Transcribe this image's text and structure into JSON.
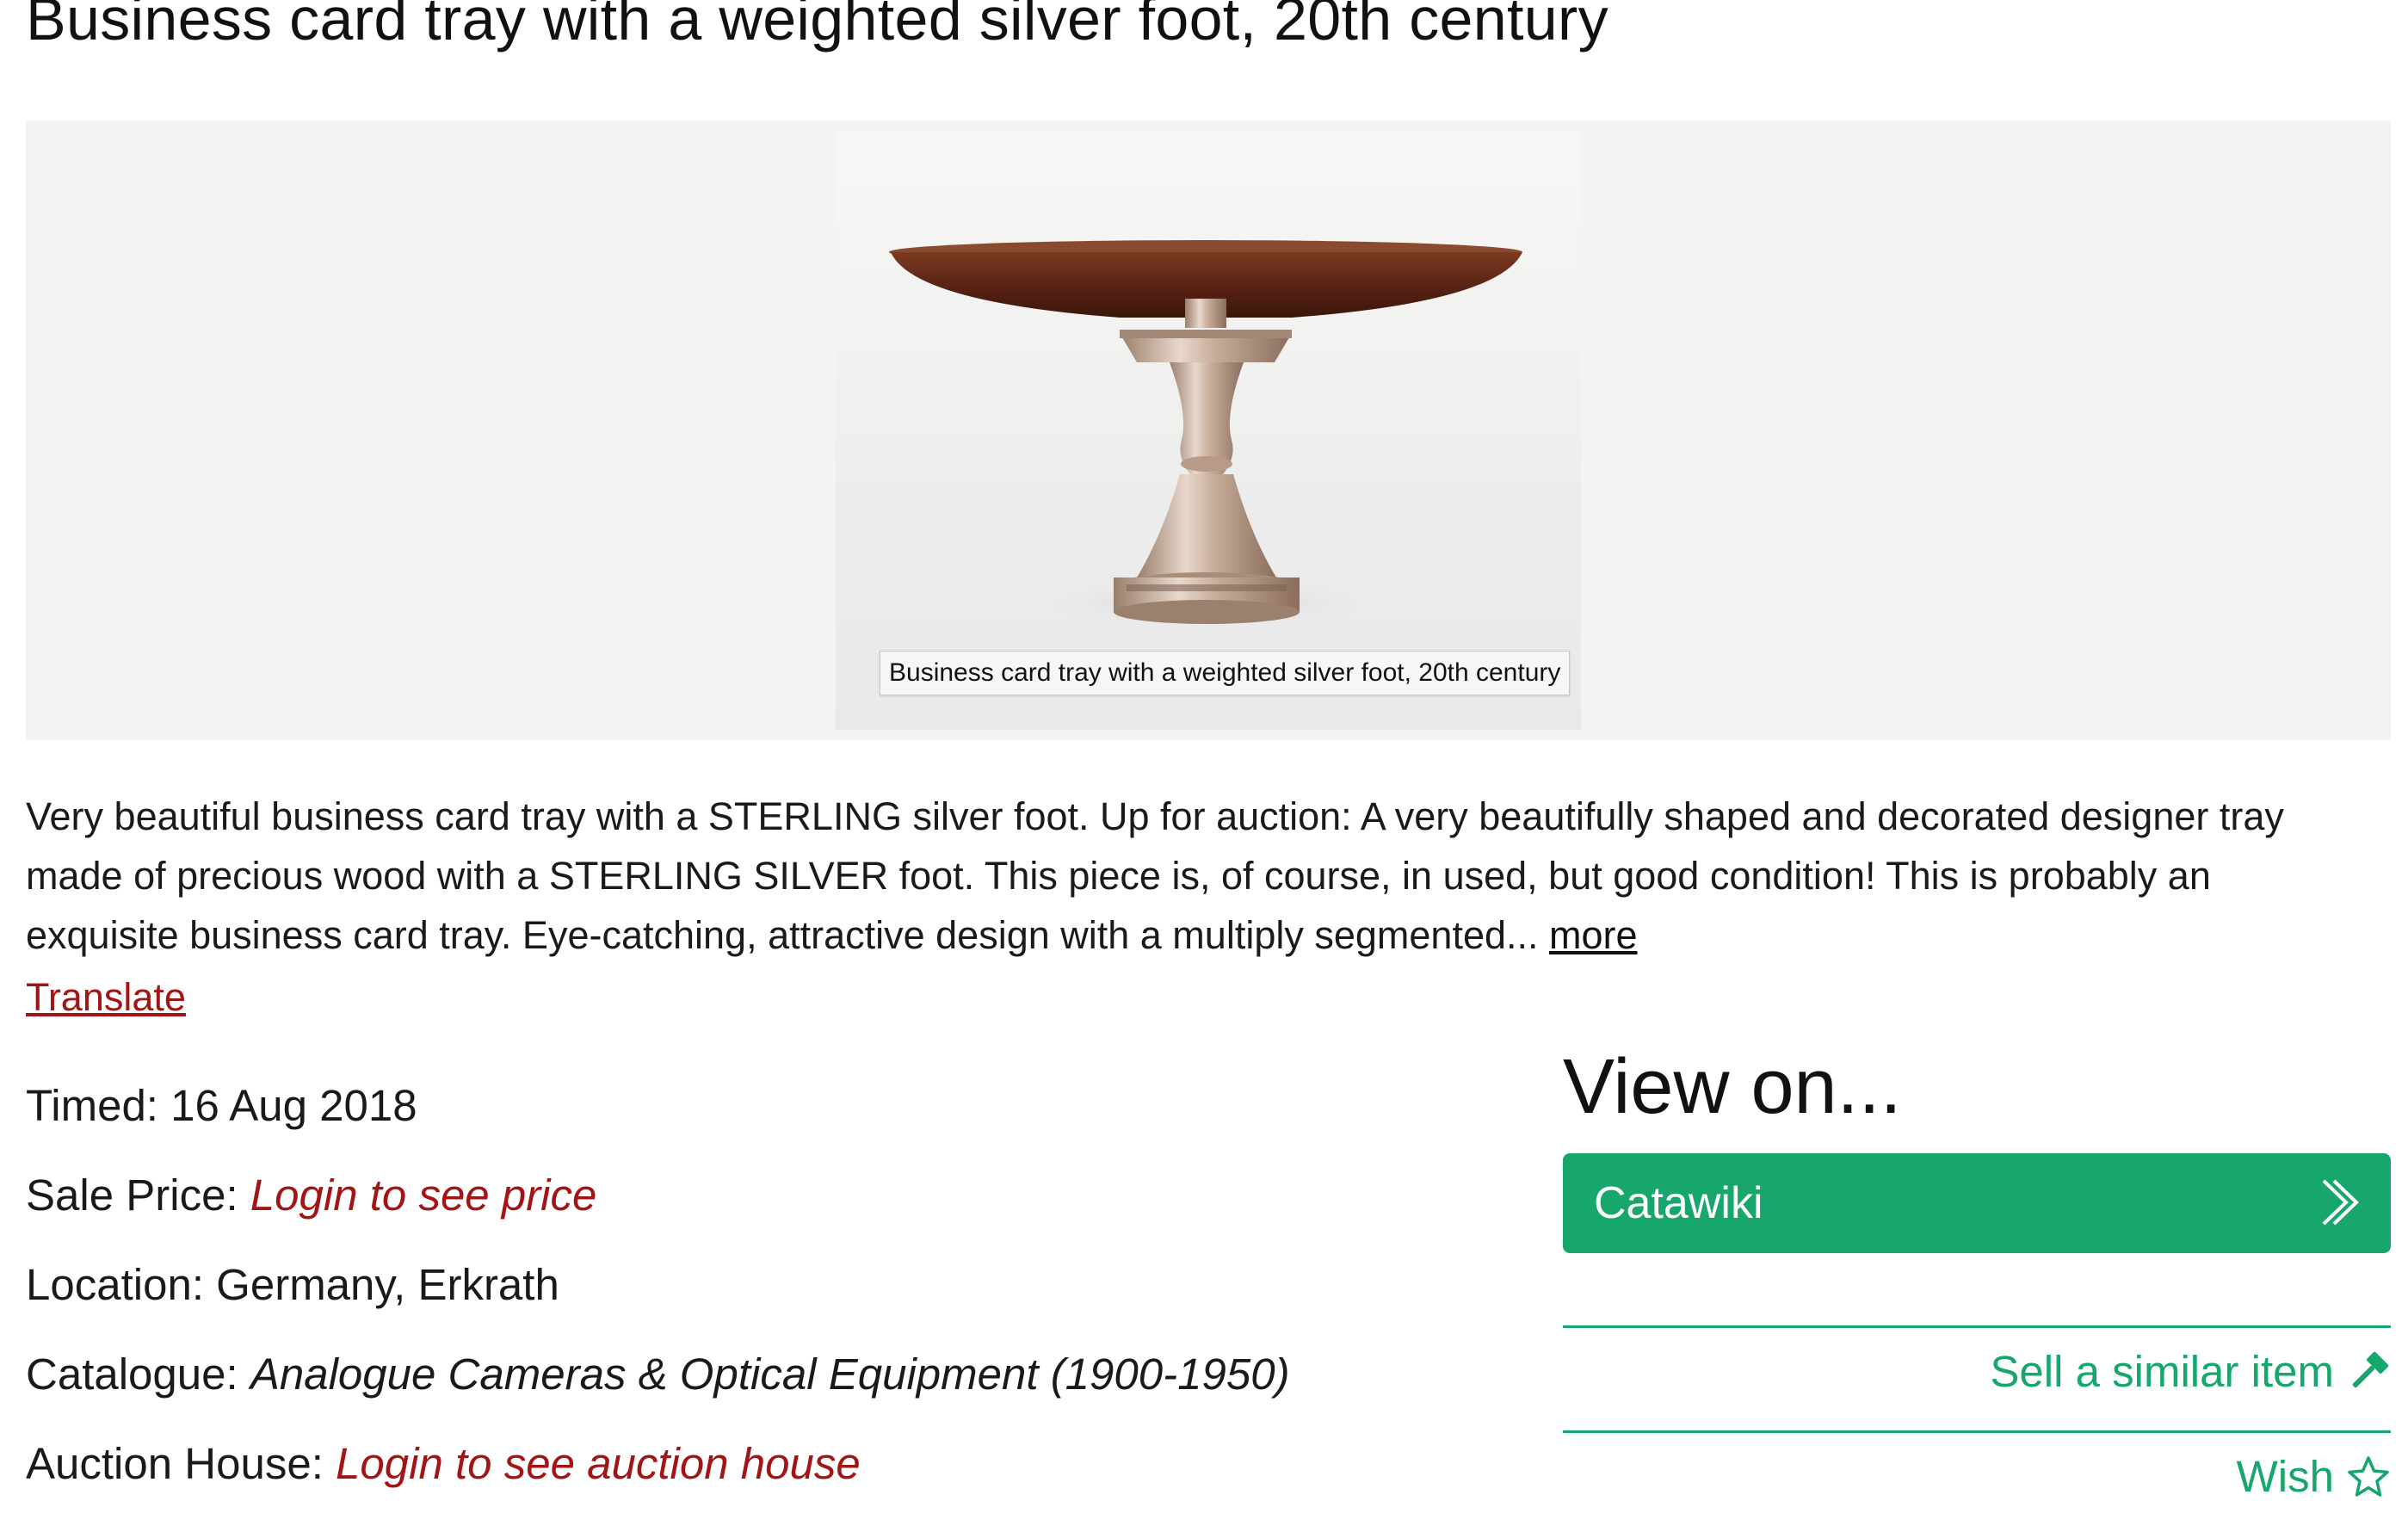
{
  "page": {
    "title": "Business card tray with a weighted silver foot, 20th century"
  },
  "image": {
    "tooltip": "Business card tray with a weighted silver foot, 20th century"
  },
  "description": {
    "text": "Very beautiful business card tray with a STERLING silver foot. Up for auction: A very beautifully shaped and decorated designer tray made of precious wood with a STERLING SILVER foot. This piece is, of course, in used, but good condition! This is probably an exquisite business card tray. Eye-catching, attractive design with a multiply segmented... ",
    "more_label": "more",
    "translate_label": "Translate"
  },
  "details": {
    "timed_label": "Timed:",
    "timed_value": "16 Aug 2018",
    "sale_price_label": "Sale Price:",
    "sale_price_value": "Login to see price",
    "location_label": "Location:",
    "location_value": "Germany, Erkrath",
    "catalogue_label": "Catalogue:",
    "catalogue_value": "Analogue Cameras & Optical Equipment (1900-1950)",
    "auction_house_label": "Auction House:",
    "auction_house_value": "Login to see auction house"
  },
  "view_on": {
    "title": "View on...",
    "button_label": "Catawiki",
    "sell_label": "Sell a similar item",
    "wish_label": "Wish"
  },
  "colors": {
    "accent_green": "#17a66c",
    "link_red": "#a31515"
  },
  "icons": {
    "catawiki_button": "chevron-right-icon",
    "sell_link": "hammer-icon",
    "wish_link": "star-outline-icon"
  }
}
